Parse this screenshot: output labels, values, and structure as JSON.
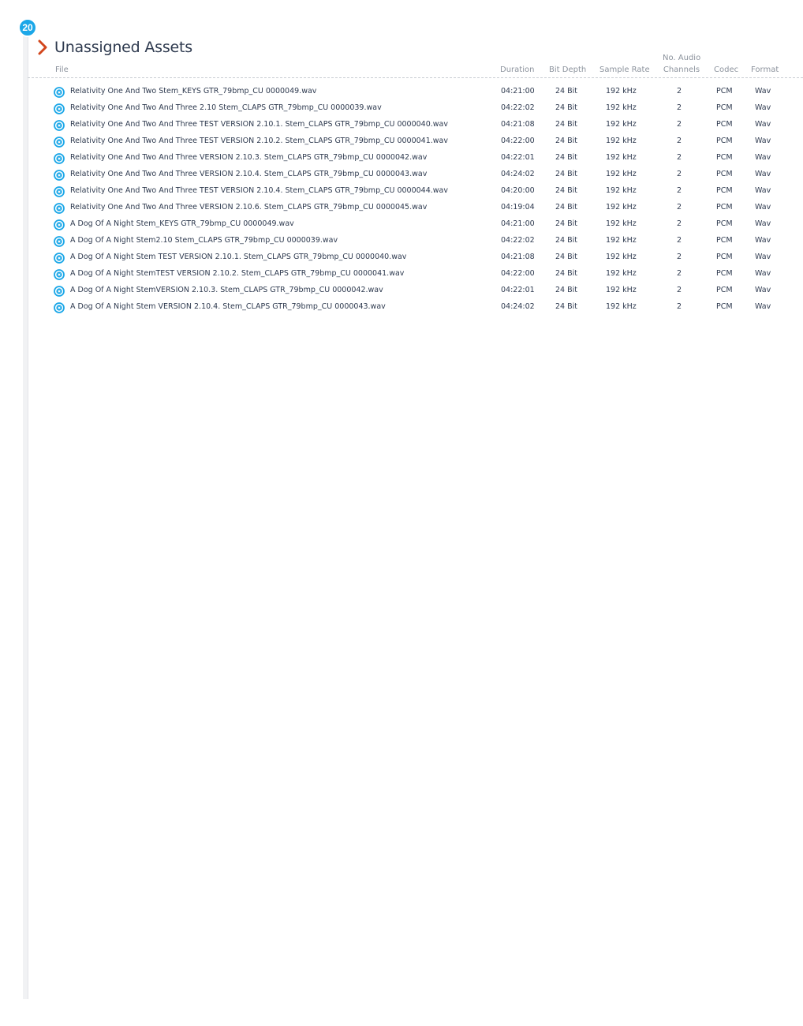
{
  "badge": "20",
  "section": {
    "title": "Unassigned Assets"
  },
  "columns": {
    "file": "File",
    "duration": "Duration",
    "bit_depth": "Bit Depth",
    "sample_rate": "Sample Rate",
    "channels_line1": "No. Audio",
    "channels_line2": "Channels",
    "codec": "Codec",
    "format": "Format"
  },
  "colors": {
    "accent": "#1ba7e8",
    "chevron": "#d2461c",
    "text": "#2e3a4f",
    "muted": "#8c939d"
  },
  "rows": [
    {
      "file": "Relativity One And Two Stem_KEYS GTR_79bmp_CU 0000049.wav",
      "duration": "04:21:00",
      "bit_depth": "24 Bit",
      "sample_rate": "192 kHz",
      "channels": "2",
      "codec": "PCM",
      "format": "Wav"
    },
    {
      "file": "Relativity One And Two And Three 2.10 Stem_CLAPS GTR_79bmp_CU 0000039.wav",
      "duration": "04:22:02",
      "bit_depth": "24 Bit",
      "sample_rate": "192 kHz",
      "channels": "2",
      "codec": "PCM",
      "format": "Wav"
    },
    {
      "file": "Relativity One And Two And Three TEST VERSION 2.10.1. Stem_CLAPS GTR_79bmp_CU 0000040.wav",
      "duration": "04:21:08",
      "bit_depth": "24 Bit",
      "sample_rate": "192 kHz",
      "channels": "2",
      "codec": "PCM",
      "format": "Wav"
    },
    {
      "file": "Relativity One And Two And Three TEST VERSION 2.10.2. Stem_CLAPS GTR_79bmp_CU 0000041.wav",
      "duration": "04:22:00",
      "bit_depth": "24 Bit",
      "sample_rate": "192 kHz",
      "channels": "2",
      "codec": "PCM",
      "format": "Wav"
    },
    {
      "file": "Relativity One And Two And Three VERSION 2.10.3. Stem_CLAPS GTR_79bmp_CU 0000042.wav",
      "duration": "04:22:01",
      "bit_depth": "24 Bit",
      "sample_rate": "192 kHz",
      "channels": "2",
      "codec": "PCM",
      "format": "Wav"
    },
    {
      "file": "Relativity One And Two And Three VERSION 2.10.4. Stem_CLAPS GTR_79bmp_CU 0000043.wav",
      "duration": "04:24:02",
      "bit_depth": "24 Bit",
      "sample_rate": "192 kHz",
      "channels": "2",
      "codec": "PCM",
      "format": "Wav"
    },
    {
      "file": "Relativity One And Two And Three TEST VERSION 2.10.4. Stem_CLAPS GTR_79bmp_CU 0000044.wav",
      "duration": "04:20:00",
      "bit_depth": "24 Bit",
      "sample_rate": "192 kHz",
      "channels": "2",
      "codec": "PCM",
      "format": "Wav"
    },
    {
      "file": "Relativity One And Two And Three VERSION 2.10.6. Stem_CLAPS GTR_79bmp_CU 0000045.wav",
      "duration": "04:19:04",
      "bit_depth": "24 Bit",
      "sample_rate": "192 kHz",
      "channels": "2",
      "codec": "PCM",
      "format": "Wav"
    },
    {
      "file": "A Dog Of A Night Stem_KEYS GTR_79bmp_CU 0000049.wav",
      "duration": "04:21:00",
      "bit_depth": "24 Bit",
      "sample_rate": "192 kHz",
      "channels": "2",
      "codec": "PCM",
      "format": "Wav"
    },
    {
      "file": "A Dog Of A Night Stem2.10 Stem_CLAPS GTR_79bmp_CU 0000039.wav",
      "duration": "04:22:02",
      "bit_depth": "24 Bit",
      "sample_rate": "192 kHz",
      "channels": "2",
      "codec": "PCM",
      "format": "Wav"
    },
    {
      "file": "A Dog Of A Night Stem TEST VERSION 2.10.1. Stem_CLAPS GTR_79bmp_CU 0000040.wav",
      "duration": "04:21:08",
      "bit_depth": "24 Bit",
      "sample_rate": "192 kHz",
      "channels": "2",
      "codec": "PCM",
      "format": "Wav"
    },
    {
      "file": "A Dog Of A Night StemTEST VERSION 2.10.2. Stem_CLAPS GTR_79bmp_CU 0000041.wav",
      "duration": "04:22:00",
      "bit_depth": "24 Bit",
      "sample_rate": "192 kHz",
      "channels": "2",
      "codec": "PCM",
      "format": "Wav"
    },
    {
      "file": "A Dog Of A Night StemVERSION 2.10.3. Stem_CLAPS GTR_79bmp_CU 0000042.wav",
      "duration": "04:22:01",
      "bit_depth": "24 Bit",
      "sample_rate": "192 kHz",
      "channels": "2",
      "codec": "PCM",
      "format": "Wav"
    },
    {
      "file": "A Dog Of A Night Stem VERSION 2.10.4. Stem_CLAPS GTR_79bmp_CU 0000043.wav",
      "duration": "04:24:02",
      "bit_depth": "24 Bit",
      "sample_rate": "192 kHz",
      "channels": "2",
      "codec": "PCM",
      "format": "Wav"
    }
  ]
}
